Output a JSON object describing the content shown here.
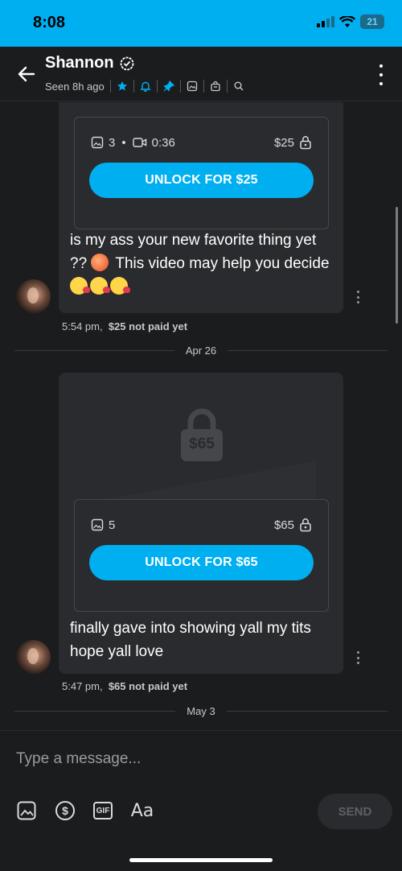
{
  "status_bar": {
    "time": "8:08",
    "battery": "21"
  },
  "header": {
    "name": "Shannon",
    "seen": "Seen 8h ago",
    "icons": [
      "star-icon",
      "bell-icon",
      "pin-icon",
      "image-icon",
      "bag-icon",
      "search-icon"
    ],
    "accent": "#00aff0"
  },
  "messages": [
    {
      "media_count": "3",
      "dot": "•",
      "video_length": "0:36",
      "price": "$25",
      "unlock_label": "UNLOCK FOR $25",
      "text_line1": "is my ass your new favorite thing yet",
      "text_line2": "?? ",
      "text_line2b": " This video may help you decide",
      "time": "5:54 pm,",
      "payment": "$25 not paid yet"
    },
    {
      "lock_price": "$65",
      "media_count": "5",
      "price": "$65",
      "unlock_label": "UNLOCK FOR $65",
      "text_line1": "finally gave into showing yall my tits",
      "text_line2": "hope yall love",
      "time": "5:47 pm,",
      "payment": "$65 not paid yet"
    }
  ],
  "dividers": [
    "Apr 26",
    "May 3"
  ],
  "composer": {
    "placeholder": "Type a message...",
    "aa_label": "Aa",
    "gif_label": "GIF",
    "send_label": "SEND"
  }
}
